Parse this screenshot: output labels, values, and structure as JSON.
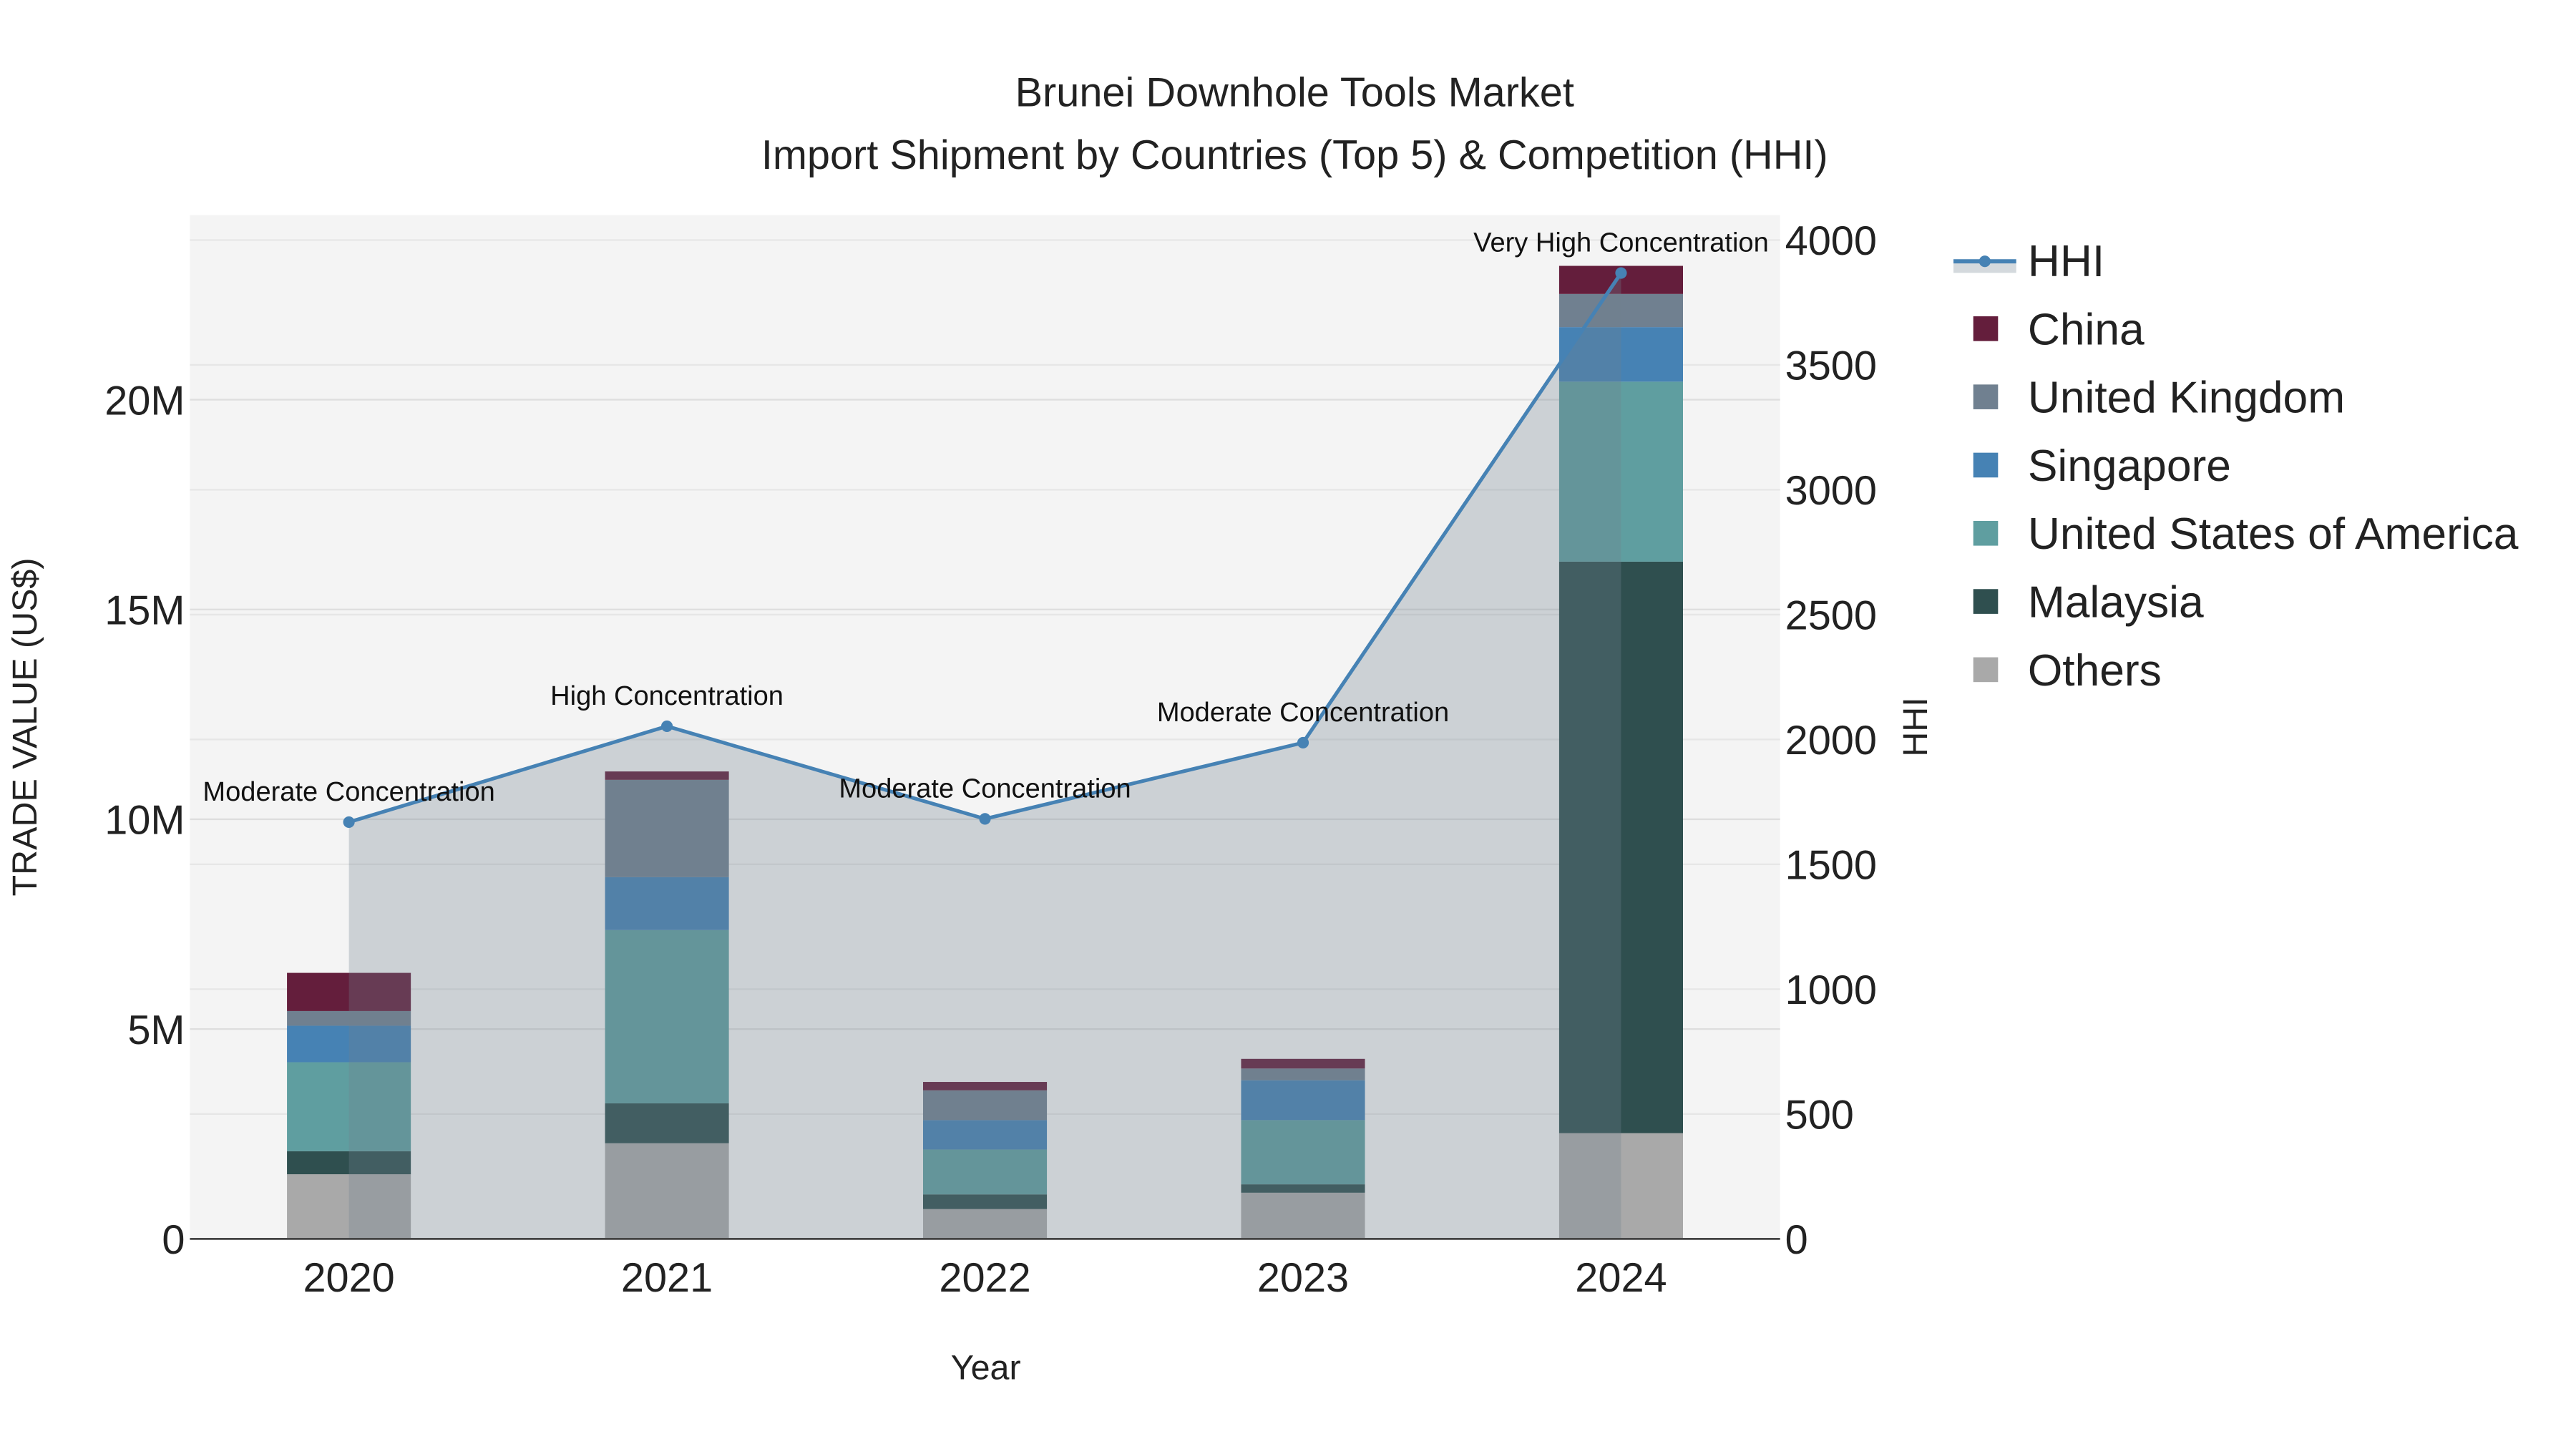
{
  "chart_data": {
    "type": "bar",
    "title": "Brunei Downhole Tools Market",
    "subtitle": "Import Shipment by Countries (Top 5) & Competition (HHI)",
    "xlabel": "Year",
    "ylabel": "TRADE VALUE (US$)",
    "y2label": "HHI",
    "categories": [
      "2020",
      "2021",
      "2022",
      "2023",
      "2024"
    ],
    "ylim": [
      0,
      24400000
    ],
    "y_ticks": [
      0,
      5000000,
      10000000,
      15000000,
      20000000
    ],
    "y_tick_labels": [
      "0",
      "5M",
      "10M",
      "15M",
      "20M"
    ],
    "y2lim": [
      0,
      4100
    ],
    "y2_ticks": [
      0,
      500,
      1000,
      1500,
      2000,
      2500,
      3000,
      3500,
      4000
    ],
    "y2_tick_labels": [
      "0",
      "500",
      "1000",
      "1500",
      "2000",
      "2500",
      "3000",
      "3500",
      "4000"
    ],
    "stacked": true,
    "grid": true,
    "legend_position": "right",
    "series": [
      {
        "name": "Others",
        "color": "#A9A9A9",
        "values": [
          1540000,
          2280000,
          710000,
          1100000,
          2520000
        ]
      },
      {
        "name": "Malaysia",
        "color": "#2F4F4F",
        "values": [
          550000,
          950000,
          350000,
          200000,
          13620000
        ]
      },
      {
        "name": "United States of America",
        "color": "#5F9EA0",
        "values": [
          2120000,
          4130000,
          1070000,
          1530000,
          4290000
        ]
      },
      {
        "name": "Singapore",
        "color": "#4682B4",
        "values": [
          870000,
          1260000,
          700000,
          950000,
          1300000
        ]
      },
      {
        "name": "United Kingdom",
        "color": "#708090",
        "values": [
          350000,
          2320000,
          710000,
          280000,
          790000
        ]
      },
      {
        "name": "China",
        "color": "#641E3C",
        "values": [
          910000,
          200000,
          200000,
          230000,
          670000
        ]
      }
    ],
    "line": {
      "name": "HHI",
      "color": "#4682B4",
      "axis": "y2",
      "values": [
        1669,
        2053,
        1682,
        1987,
        3868
      ],
      "annotations": [
        "Moderate Concentration",
        "High Concentration",
        "Moderate Concentration",
        "Moderate Concentration",
        "Very High Concentration"
      ]
    },
    "legend_order": [
      "HHI",
      "China",
      "United Kingdom",
      "Singapore",
      "United States of America",
      "Malaysia",
      "Others"
    ]
  }
}
